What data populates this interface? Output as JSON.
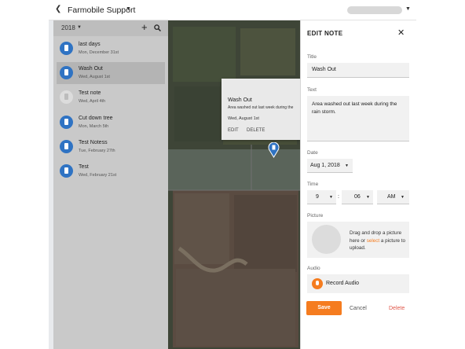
{
  "topbar": {
    "title": "Farmobile Support",
    "back_icon": "chevron-left-icon",
    "user_menu": "user-menu"
  },
  "sidebar": {
    "year": "2018",
    "notes": [
      {
        "title": "last days",
        "date": "Mon, December 31st",
        "icon": "note-icon"
      },
      {
        "title": "Wash Out",
        "date": "Wed, August 1st",
        "icon": "note-icon",
        "selected": true
      },
      {
        "title": "Test note",
        "date": "Wed, April 4th",
        "icon": "note-grey-icon"
      },
      {
        "title": "Cut down tree",
        "date": "Mon, March 5th",
        "icon": "note-icon"
      },
      {
        "title": "Test Notess",
        "date": "Tue, February 27th",
        "icon": "note-icon"
      },
      {
        "title": "Test",
        "date": "Wed, February 21st",
        "icon": "note-icon"
      }
    ]
  },
  "popup": {
    "title": "Wash Out",
    "text": "Area washed out last week during the",
    "date": "Wed, August 1st",
    "edit_label": "EDIT",
    "delete_label": "DELETE"
  },
  "panel": {
    "heading": "EDIT NOTE",
    "title_label": "Title",
    "title_value": "Wash Out",
    "text_label": "Text",
    "text_value": "Area washed out last week during the rain storm.",
    "date_label": "Date",
    "date_value": "Aug 1, 2018",
    "time_label": "Time",
    "hour": "9",
    "minute": "06",
    "ampm": "AM",
    "picture_label": "Picture",
    "picture_text_before": "Drag and drop a picture here or ",
    "picture_link": "select",
    "picture_text_after": " a picture to upload.",
    "audio_label": "Audio",
    "audio_button": "Record Audio",
    "save_label": "Save",
    "cancel_label": "Cancel",
    "delete_label": "Delete"
  },
  "colors": {
    "accent": "#f57c1f",
    "note_icon": "#2f73c3",
    "delete": "#e0574a"
  }
}
